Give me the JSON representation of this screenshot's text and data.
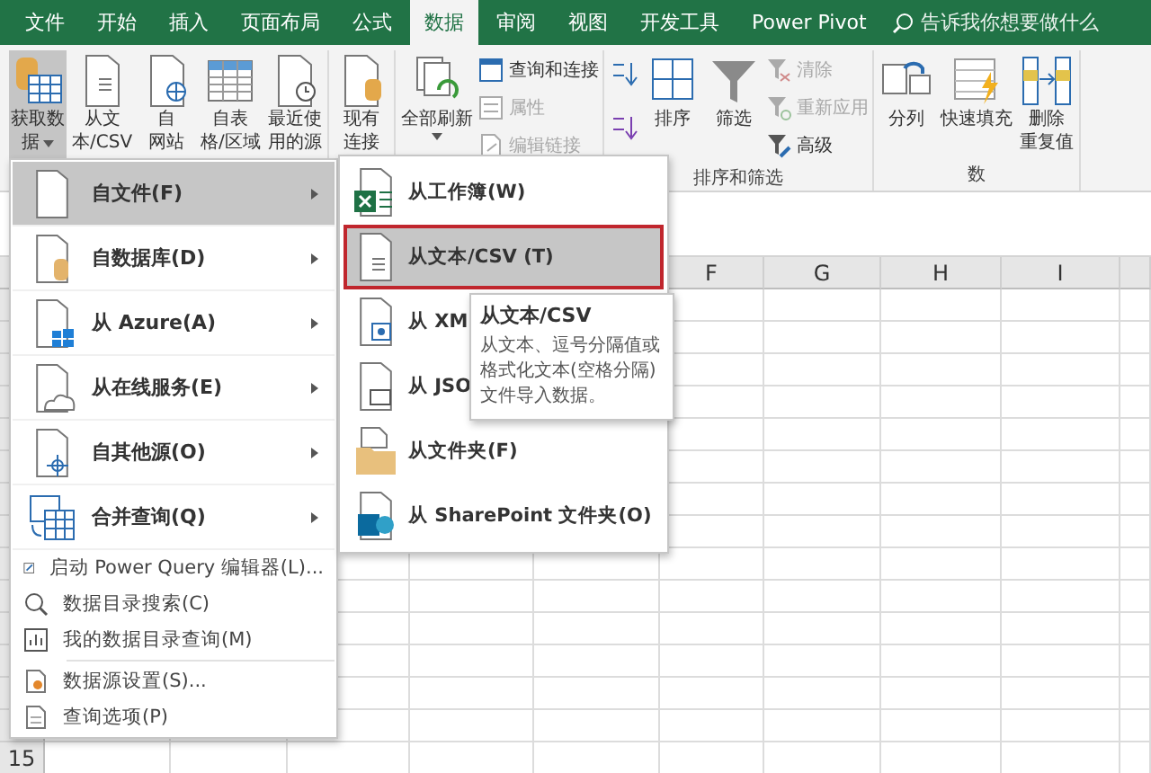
{
  "tabs": [
    {
      "label": "文件",
      "selected": false
    },
    {
      "label": "开始",
      "selected": false
    },
    {
      "label": "插入",
      "selected": false
    },
    {
      "label": "页面布局",
      "selected": false
    },
    {
      "label": "公式",
      "selected": false
    },
    {
      "label": "数据",
      "selected": true
    },
    {
      "label": "审阅",
      "selected": false
    },
    {
      "label": "视图",
      "selected": false
    },
    {
      "label": "开发工具",
      "selected": false
    },
    {
      "label": "Power Pivot",
      "selected": false
    }
  ],
  "tell_me": {
    "placeholder": "告诉我你想要做什么"
  },
  "ribbon": {
    "groups": [
      {
        "items": [
          {
            "kind": "large",
            "lines": [
              "获取数",
              "据"
            ],
            "dropdown": true,
            "selected": true
          },
          {
            "kind": "large",
            "lines": [
              "从文",
              "本/CSV"
            ],
            "dropdown": false,
            "selected": false
          },
          {
            "kind": "large",
            "lines": [
              "自",
              "网站"
            ],
            "dropdown": false,
            "selected": false
          },
          {
            "kind": "large",
            "lines": [
              "自表",
              "格/区域"
            ],
            "dropdown": false,
            "selected": false
          },
          {
            "kind": "large",
            "lines": [
              "最近使",
              "用的源"
            ],
            "dropdown": false,
            "selected": false
          }
        ]
      },
      {
        "items": [
          {
            "kind": "large",
            "lines": [
              "现有",
              "连接"
            ],
            "dropdown": false,
            "selected": false
          }
        ]
      },
      {
        "items": [
          {
            "kind": "large",
            "lines": [
              "全部刷新"
            ],
            "dropdown": true,
            "selected": false
          },
          {
            "kind": "stack",
            "entries": [
              {
                "label": "查询和连接",
                "disabled": false
              },
              {
                "label": "属性",
                "disabled": true
              },
              {
                "label": "编辑链接",
                "disabled": true
              }
            ]
          }
        ]
      },
      {
        "label": "排序和筛选",
        "items": [
          {
            "kind": "sort-pair"
          },
          {
            "kind": "large",
            "lines": [
              "排序"
            ],
            "dropdown": false,
            "selected": false
          },
          {
            "kind": "large",
            "lines": [
              "筛选"
            ],
            "dropdown": false,
            "selected": false
          },
          {
            "kind": "stack",
            "entries": [
              {
                "label": "清除",
                "disabled": true
              },
              {
                "label": "重新应用",
                "disabled": true
              },
              {
                "label": "高级",
                "disabled": false
              }
            ]
          }
        ]
      },
      {
        "label": "数",
        "items": [
          {
            "kind": "large",
            "lines": [
              "分列"
            ],
            "dropdown": false,
            "selected": false
          },
          {
            "kind": "large",
            "lines": [
              "快速填充"
            ],
            "dropdown": false,
            "selected": false
          },
          {
            "kind": "large",
            "lines": [
              "删除",
              "重复值"
            ],
            "dropdown": false,
            "selected": false
          }
        ]
      }
    ]
  },
  "sheet": {
    "columns": [
      "F",
      "G",
      "H",
      "I"
    ],
    "row_numbers": [
      "15"
    ]
  },
  "menu": {
    "items": [
      {
        "label": "自文件(F)",
        "selected": true
      },
      {
        "label": "自数据库(D)",
        "selected": false
      },
      {
        "label": "从 Azure(A)",
        "selected": false
      },
      {
        "label": "从在线服务(E)",
        "selected": false
      },
      {
        "label": "自其他源(O)",
        "selected": false
      },
      {
        "label": "合并查询(Q)",
        "selected": false
      }
    ],
    "small_groups": [
      [
        "启动 Power Query 编辑器(L)...",
        "数据目录搜索(C)",
        "我的数据目录查询(M)"
      ],
      [
        "数据源设置(S)...",
        "查询选项(P)"
      ]
    ]
  },
  "submenu": {
    "items": [
      {
        "label": "从工作簿(W)",
        "selected": false
      },
      {
        "label": "从文本/CSV (T)",
        "selected": true
      },
      {
        "label": "从 XM",
        "selected": false
      },
      {
        "label": "从 JSO",
        "selected": false
      },
      {
        "label": "从文件夹(F)",
        "selected": false
      },
      {
        "label": "从 SharePoint 文件夹(O)",
        "selected": false
      }
    ]
  },
  "tooltip": {
    "title": "从文本/CSV",
    "body": "从文本、逗号分隔值或格式化文本(空格分隔)文件导入数据。"
  }
}
